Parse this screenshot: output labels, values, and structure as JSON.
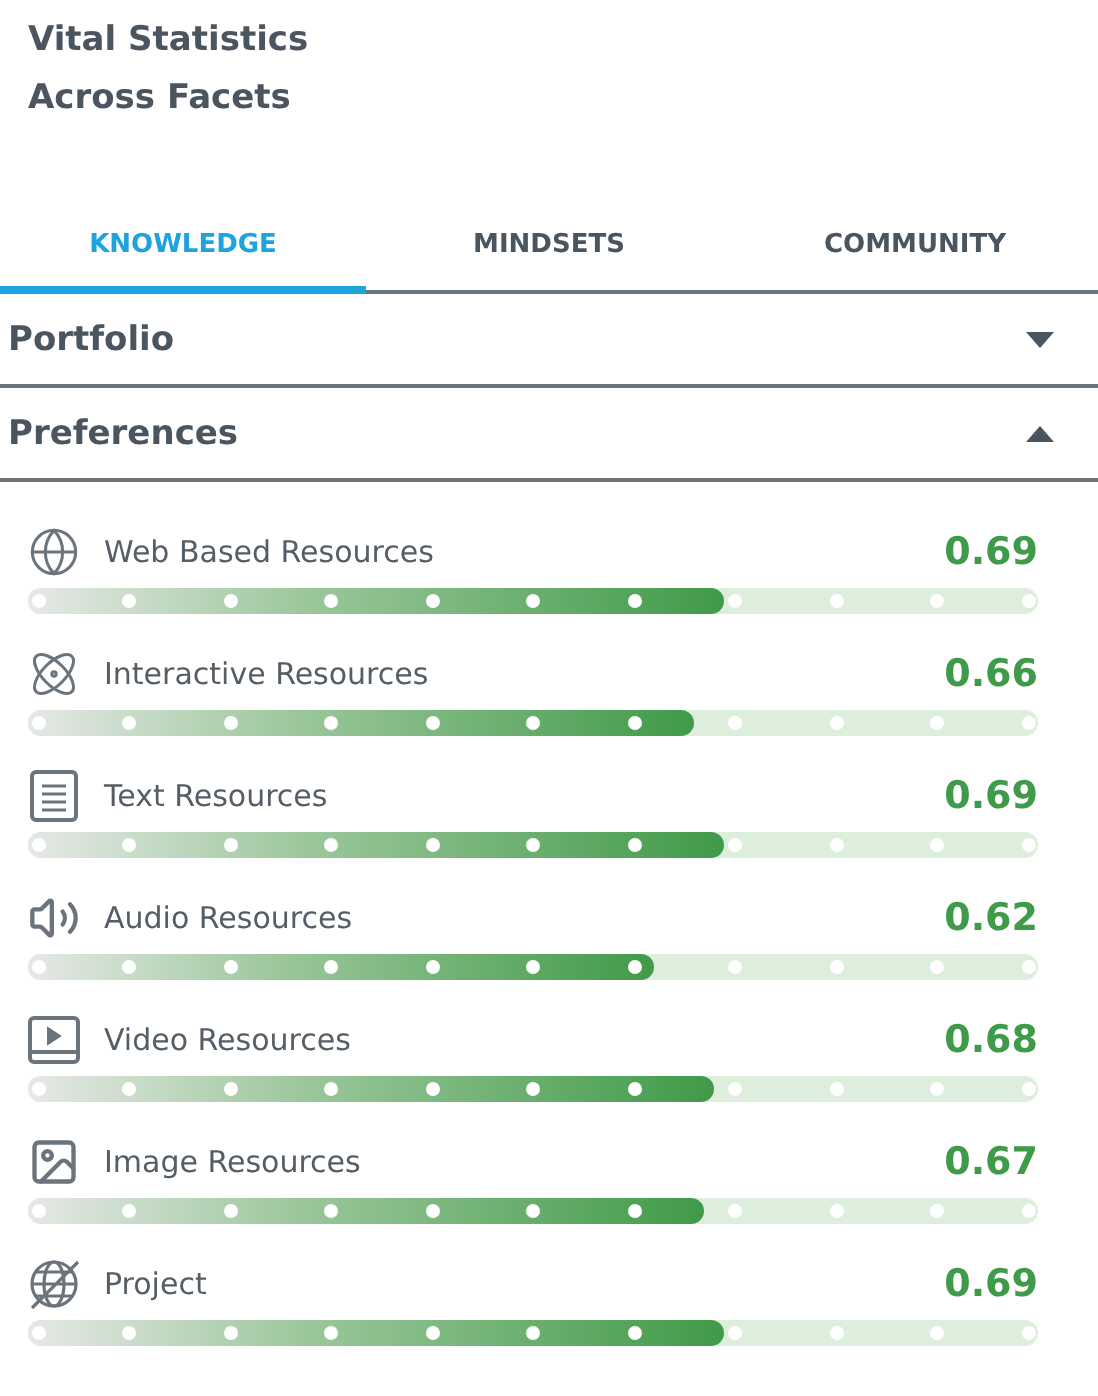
{
  "title_lines": [
    "Vital Statistics",
    "Across Facets"
  ],
  "tabs": [
    {
      "label": "KNOWLEDGE",
      "selected": true
    },
    {
      "label": "MINDSETS",
      "selected": false
    },
    {
      "label": "COMMUNITY",
      "selected": false
    }
  ],
  "sections": [
    {
      "title": "Portfolio",
      "expanded": false
    },
    {
      "title": "Preferences",
      "expanded": true
    }
  ],
  "preferences": [
    {
      "name": "Web Based Resources",
      "value": "0.69",
      "level": 0.69
    },
    {
      "name": "Interactive Resources",
      "value": "0.66",
      "level": 0.66
    },
    {
      "name": "Text Resources",
      "value": "0.69",
      "level": 0.69
    },
    {
      "name": "Audio Resources",
      "value": "0.62",
      "level": 0.62
    },
    {
      "name": "Video Resources",
      "value": "0.68",
      "level": 0.68
    },
    {
      "name": "Image Resources",
      "value": "0.67",
      "level": 0.67
    },
    {
      "name": "Project",
      "value": "0.69",
      "level": 0.69
    }
  ]
}
